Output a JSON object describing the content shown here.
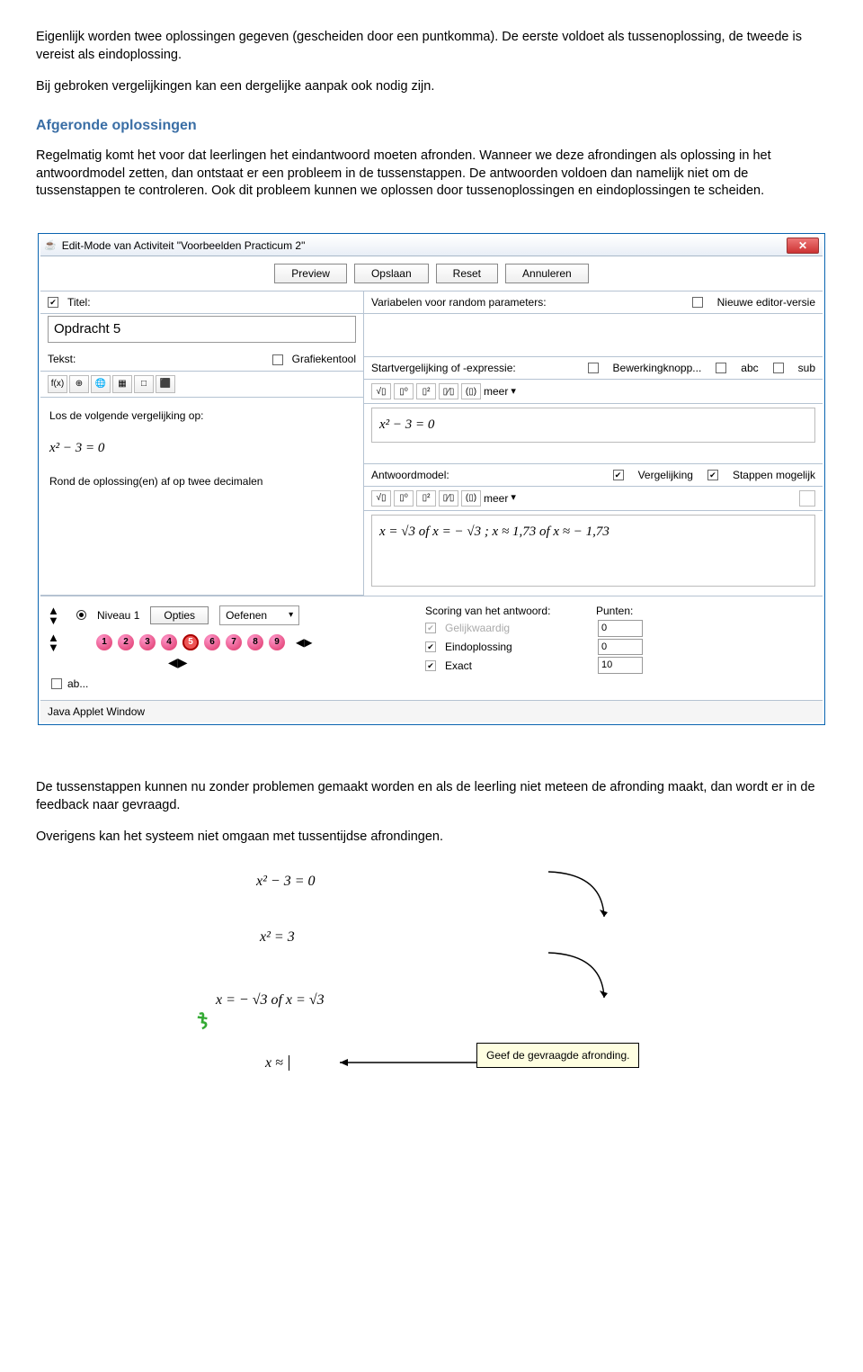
{
  "doc": {
    "p1": "Eigenlijk worden twee oplossingen gegeven (gescheiden door een puntkomma). De eerste voldoet als tussenoplossing, de tweede is vereist als eindoplossing.",
    "p2": "Bij gebroken vergelijkingen kan een dergelijke aanpak ook nodig zijn.",
    "h1": "Afgeronde oplossingen",
    "p3": "Regelmatig komt het voor dat leerlingen het eindantwoord moeten afronden. Wanneer we deze afrondingen als oplossing in het antwoordmodel zetten, dan ontstaat er een probleem in de tussenstappen. De antwoorden voldoen dan namelijk niet om de tussenstappen te controleren. Ook dit probleem kunnen we oplossen door tussenoplossingen en eindoplossingen te scheiden.",
    "p4": "De tussenstappen kunnen nu zonder problemen gemaakt worden en als de leerling niet meteen de afronding maakt, dan wordt er in de feedback naar gevraagd.",
    "p5": "Overigens kan het systeem niet omgaan met tussentijdse afrondingen."
  },
  "window": {
    "title": "Edit-Mode van Activiteit \"Voorbeelden Practicum 2\"",
    "buttons": {
      "preview": "Preview",
      "opslaan": "Opslaan",
      "reset": "Reset",
      "annuleren": "Annuleren"
    },
    "labels": {
      "titel": "Titel:",
      "vars": "Variabelen voor random parameters:",
      "nev": "Nieuwe editor-versie",
      "tekst": "Tekst:",
      "grafiek": "Grafiekentool",
      "startv": "Startvergelijking of -expressie:",
      "bewerk": "Bewerkingknopp...",
      "abc": "abc",
      "sub": "sub",
      "antwoord": "Antwoordmodel:",
      "vergelijking": "Vergelijking",
      "stappen": "Stappen mogelijk",
      "meer": "meer",
      "scoring": "Scoring van het antwoord:",
      "punten": "Punten:",
      "gelijk": "Gelijkwaardig",
      "eind": "Eindoplossing",
      "exact": "Exact",
      "niveau": "Niveau 1",
      "opties": "Opties",
      "oefenen": "Oefenen",
      "ab": "ab...",
      "status": "Java Applet Window"
    },
    "values": {
      "titel": "Opdracht 5",
      "tekst_l1": "Los de volgende vergelijking op:",
      "tekst_eq": "x² − 3 = 0",
      "tekst_l2": "Rond de oplossing(en) af op twee decimalen",
      "start_eq": "x² − 3 = 0",
      "antwoord_eq": "x = √3  of x = − √3  ; x ≈ 1,73 of x  ≈  − 1,73",
      "pt0a": "0",
      "pt0b": "0",
      "pt10": "10"
    },
    "toolbox": [
      "f(x)",
      "⊕",
      "🌐",
      "▦",
      "□",
      "⬛"
    ],
    "mini": [
      "√▯",
      "▯⁰",
      "▯²",
      "▯⁄▯",
      "(▯)"
    ],
    "numballs": [
      "1",
      "2",
      "3",
      "4",
      "5",
      "6",
      "7",
      "8",
      "9"
    ]
  },
  "fig": {
    "e1": "x² − 3 = 0",
    "e2": "x² = 3",
    "e3": "x = − √3  of  x = √3",
    "e4": "x ≈",
    "feedback": "Geef de gevraagde afronding."
  }
}
